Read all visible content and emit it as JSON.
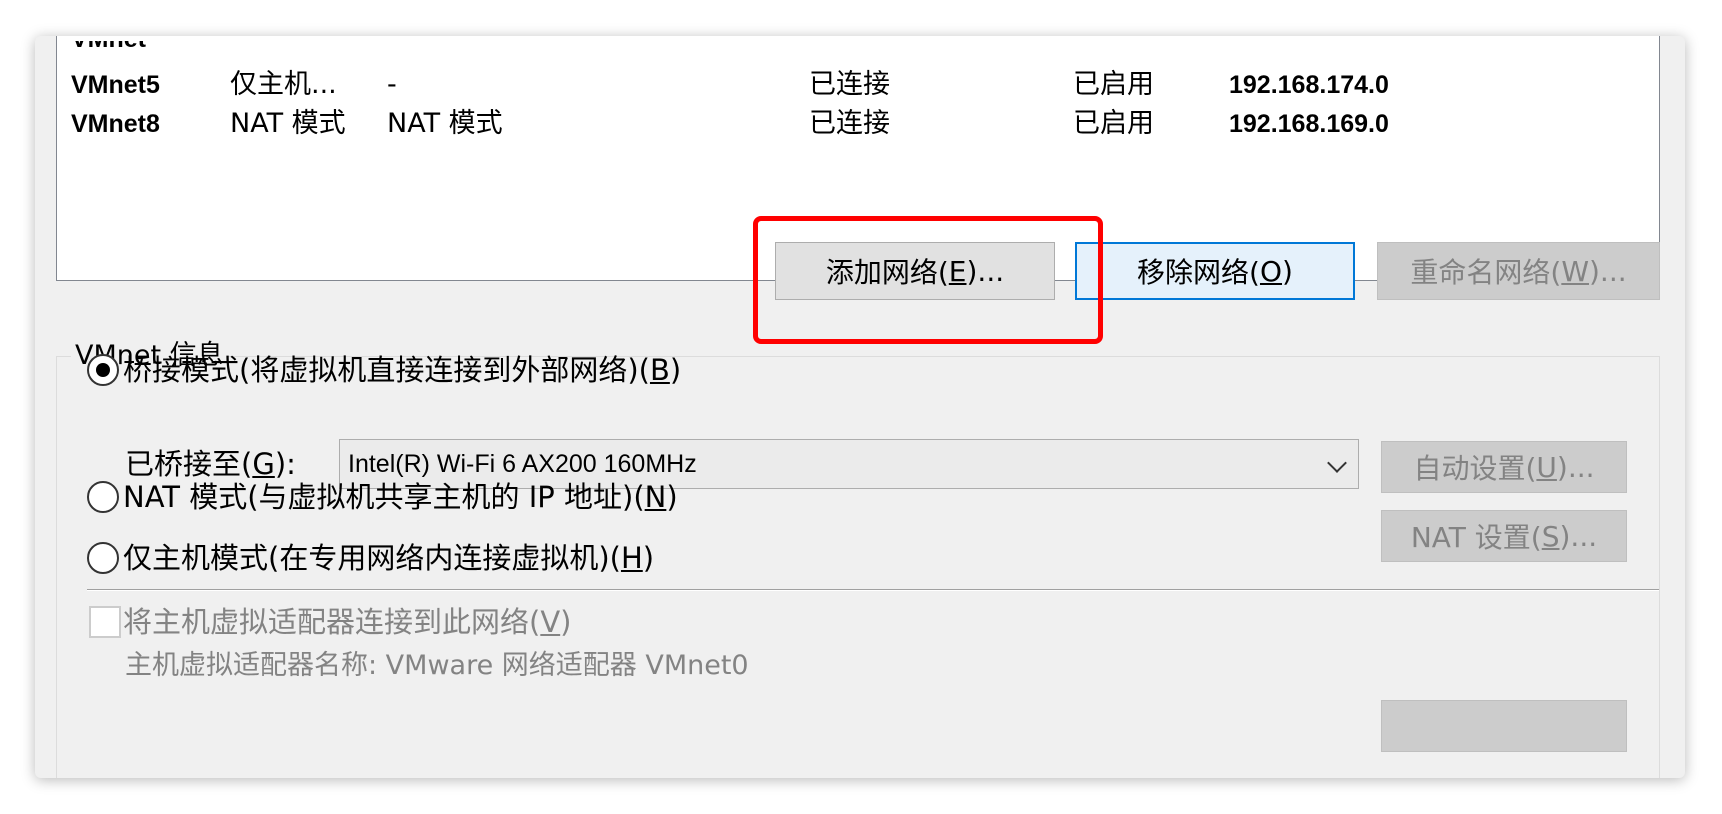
{
  "networks": {
    "rows": [
      {
        "name": "VMnet5",
        "type": "仅主机...",
        "external": "-",
        "host": "已连接",
        "dhcp": "已启用",
        "subnet": "192.168.174.0"
      },
      {
        "name": "VMnet8",
        "type": "NAT 模式",
        "external": "NAT 模式",
        "host": "已连接",
        "dhcp": "已启用",
        "subnet": "192.168.169.0"
      }
    ]
  },
  "buttons": {
    "add_network": {
      "text": "添加网络(",
      "key": "E",
      "suffix": ")..."
    },
    "remove_network": {
      "text": "移除网络(",
      "key": "O",
      "suffix": ")"
    },
    "rename_network": {
      "text": "重命名网络(",
      "key": "W",
      "suffix": ")..."
    }
  },
  "vmnet_info": {
    "title": "VMnet 信息",
    "bridged_mode": {
      "text": "桥接模式(将虚拟机直接连接到外部网络)(",
      "key": "B",
      "suffix": ")",
      "selected": true
    },
    "bridged_to": {
      "text": "已桥接至(",
      "key": "G",
      "suffix": "):"
    },
    "adapter_select": {
      "value": "Intel(R) Wi-Fi 6 AX200 160MHz"
    },
    "auto_settings": {
      "text": "自动设置(",
      "key": "U",
      "suffix": ")..."
    },
    "nat_mode": {
      "text": "NAT 模式(与虚拟机共享主机的 IP 地址)(",
      "key": "N",
      "suffix": ")",
      "selected": false
    },
    "nat_settings": {
      "text": "NAT 设置(",
      "key": "S",
      "suffix": ")..."
    },
    "host_only": {
      "text": "仅主机模式(在专用网络内连接虚拟机)(",
      "key": "H",
      "suffix": ")",
      "selected": false
    },
    "connect_adapter": {
      "text": "将主机虚拟适配器连接到此网络(",
      "key": "V",
      "suffix": ")",
      "checked": false
    },
    "adapter_name": "主机虚拟适配器名称: VMware 网络适配器 VMnet0"
  },
  "colors": {
    "highlight": "#ff0000",
    "focus": "#0078d7"
  }
}
